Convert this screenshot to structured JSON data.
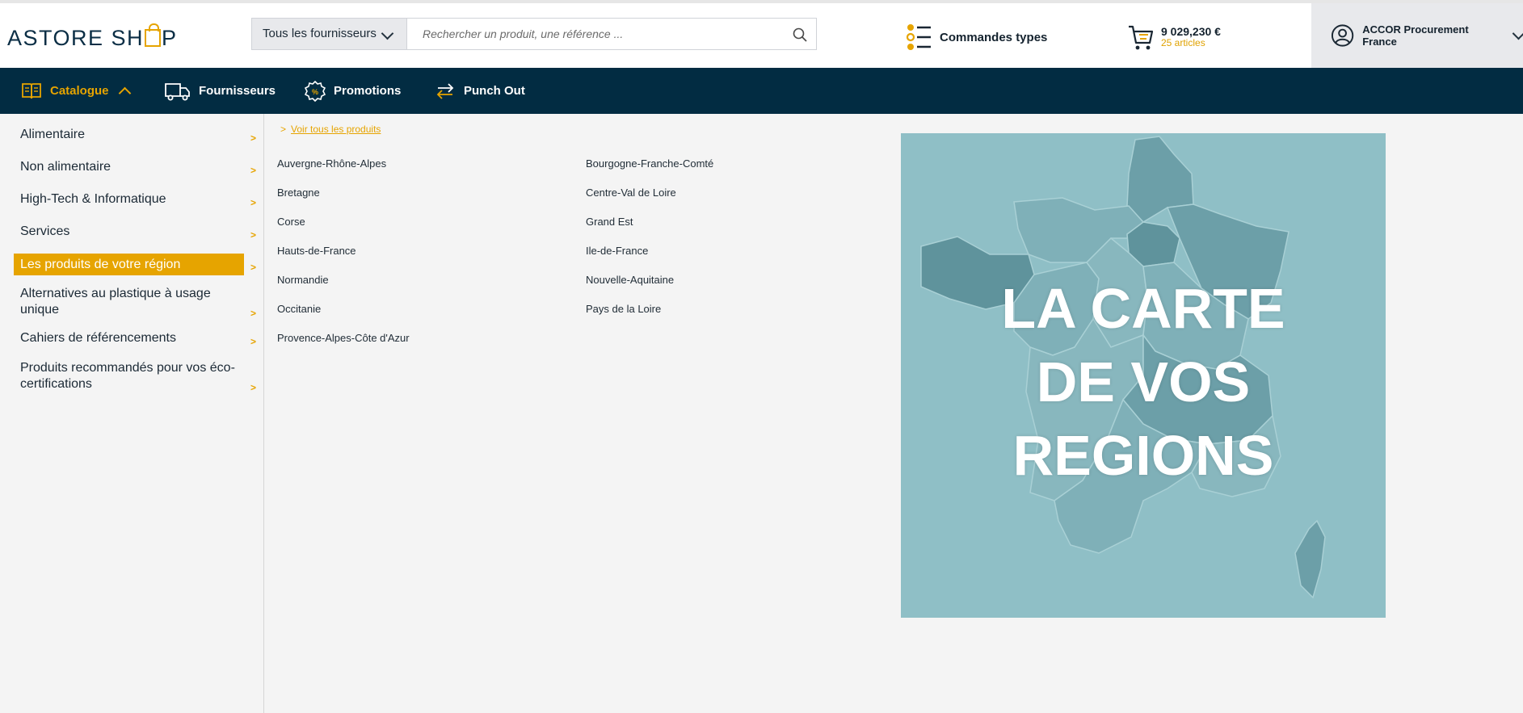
{
  "header": {
    "logo_part1": "ASTORE SH",
    "logo_part2": "P",
    "supplier_select": "Tous les fournisseurs",
    "search_placeholder": "Rechercher un produit, une référence ...",
    "commandes_label": "Commandes types",
    "cart_total": "9 029,230 €",
    "cart_count": "25 articles",
    "account_label": "ACCOR Procurement France"
  },
  "nav": {
    "items": [
      {
        "label": "Catalogue",
        "icon": "book-icon",
        "active": true
      },
      {
        "label": "Fournisseurs",
        "icon": "truck-icon"
      },
      {
        "label": "Promotions",
        "icon": "promo-badge-icon"
      },
      {
        "label": "Punch Out",
        "icon": "swap-arrows-icon"
      }
    ]
  },
  "sidebar": {
    "arrow": ">",
    "categories": [
      "Alimentaire",
      "Non alimentaire",
      "High-Tech & Informatique",
      "Services",
      "Les produits de votre région",
      "Alternatives au plastique à usage unique",
      "Cahiers de référencements",
      "Produits recommandés pour vos éco-certifications"
    ]
  },
  "regions": {
    "voir_tous_prefix": ">",
    "voir_tous": "Voir tous les produits",
    "col1": [
      "Auvergne-Rhône-Alpes",
      "Bretagne",
      "Corse",
      "Hauts-de-France",
      "Normandie",
      "Occitanie",
      "Provence-Alpes-Côte d'Azur"
    ],
    "col2": [
      "Bourgogne-Franche-Comté",
      "Centre-Val de Loire",
      "Grand Est",
      "Ile-de-France",
      "Nouvelle-Aquitaine",
      "Pays de la Loire"
    ]
  },
  "banner": {
    "line1": "LA CARTE",
    "line2": "DE VOS",
    "line3": "REGIONS"
  },
  "colors": {
    "accent": "#e6a400",
    "nav_bg": "#022c42",
    "banner_bg": "#8fbfc6"
  }
}
